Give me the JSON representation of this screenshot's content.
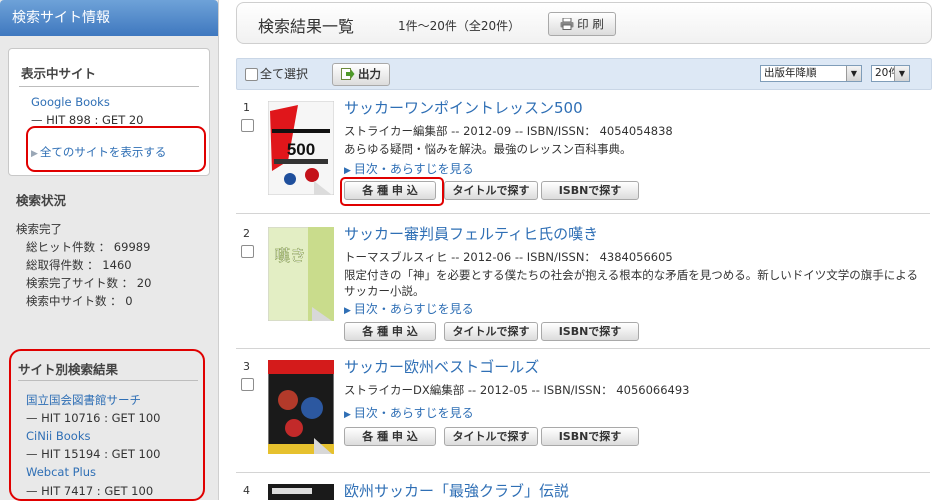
{
  "sidebar": {
    "header": "検索サイト情報",
    "current_sites": {
      "title": "表示中サイト",
      "site": {
        "name": "Google Books",
        "stats": "— HIT 898 : GET 20"
      },
      "show_all": "全てのサイトを表示する"
    },
    "status": {
      "title": "検索状況",
      "lines": [
        "検索完了",
        "総ヒット件数 ： 69989",
        "総取得件数 ： 1460",
        "検索完了サイト数 ： 20",
        "検索中サイト数 ： 0"
      ]
    },
    "results_by_site": {
      "title": "サイト別検索結果",
      "sites": [
        {
          "name": "国立国会図書館サーチ",
          "stats": "— HIT 10716 : GET 100"
        },
        {
          "name": "CiNii Books",
          "stats": "— HIT 15194 : GET 100"
        },
        {
          "name": "Webcat Plus",
          "stats": "— HIT 7417 : GET 100"
        }
      ]
    }
  },
  "header": {
    "title": "検索結果一覧",
    "range": "1件～20件（全20件）",
    "print_label": "印 刷"
  },
  "toolbar": {
    "select_all": "全て選択",
    "output_label": "出力",
    "sort_value": "出版年降順",
    "count_value": "20件"
  },
  "buttons": {
    "apply": "各 種 申 込",
    "by_title": "タイトルで探す",
    "by_isbn": "ISBNで探す"
  },
  "results": [
    {
      "num": "1",
      "title": "サッカーワンポイントレッスン500",
      "meta": "ストライカー編集部 -- 2012-09 -- ISBN/ISSN： 4054054838",
      "desc": "あらゆる疑問・悩みを解決。最強のレッスン百科事典。",
      "toc": "目次・あらすじを見る",
      "cover_text": "500"
    },
    {
      "num": "2",
      "title": "サッカー審判員フェルティヒ氏の嘆き",
      "meta": "トーマスブルスィヒ -- 2012-06 -- ISBN/ISSN： 4384056605",
      "desc": "限定付きの「神」を必要とする僕たちの社会が抱える根本的な矛盾を見つめる。新しいドイツ文学の旗手によるサッカー小説。",
      "toc": "目次・あらすじを見る",
      "cover_text": "嘆き"
    },
    {
      "num": "3",
      "title": "サッカー欧州ベストゴールズ",
      "meta": "ストライカーDX編集部 -- 2012-05 -- ISBN/ISSN： 4056066493",
      "desc": "",
      "toc": "目次・あらすじを見る",
      "cover_text": ""
    },
    {
      "num": "4",
      "title": "欧州サッカー「最強クラブ」伝説"
    }
  ],
  "colors": {
    "accent_blue": "#2f6fb5",
    "highlight_red": "#e00000",
    "header_blue": "#3f78bf"
  }
}
